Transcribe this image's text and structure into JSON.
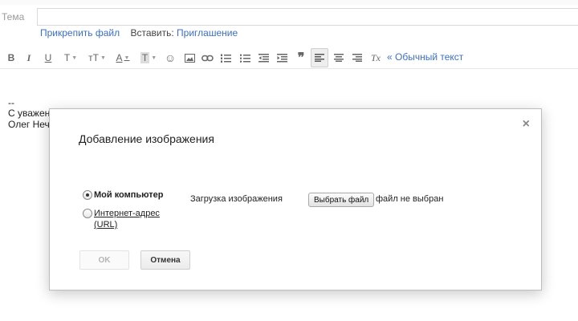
{
  "compose": {
    "subject_label": "Тема",
    "attach_link": "Прикрепить файл",
    "insert_label": "Вставить:",
    "invitation_link": "Приглашение",
    "plain_text_link": "« Обычный текст",
    "signature": {
      "dash": "--",
      "line1": "С уважен",
      "line2": "Олег Неча"
    }
  },
  "toolbar": {
    "bold": "B",
    "italic": "I",
    "underline": "U",
    "font": "T",
    "size": "тT",
    "text_color": "A",
    "bg_color": "T",
    "emoji": "☺",
    "quote": "❞",
    "remove_format": "Tx"
  },
  "dialog": {
    "title": "Добавление изображения",
    "close": "×",
    "option_computer": "Мой компьютер",
    "option_url": "Интернет-адрес (URL)",
    "upload_label": "Загрузка изображения",
    "choose_file": "Выбрать файл",
    "no_file": "файл не выбран",
    "ok": "OK",
    "cancel": "Отмена"
  }
}
